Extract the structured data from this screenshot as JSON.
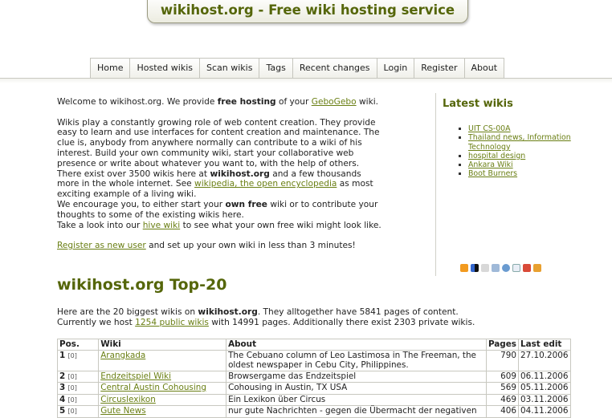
{
  "site": {
    "title": "wikihost.org - Free wiki hosting service"
  },
  "nav": {
    "tabs": [
      "Home",
      "Hosted wikis",
      "Scan wikis",
      "Tags",
      "Recent changes",
      "Login",
      "Register",
      "About"
    ]
  },
  "intro": {
    "p1_pre": "Welcome to wikihost.org. We provide ",
    "p1_bold": "free hosting",
    "p1_mid": " of your ",
    "p1_link": "GeboGebo",
    "p1_post": " wiki.",
    "p2_a": "Wikis play a constantly growing role of web content creation. They provide easy to learn and use interfaces for content creation and maintenance. The clue is, anybody from anywhere normally can contribute to a wiki of his interest. Build your own community wiki, start your collaborative web presence or write about whatever you want to, with the help of others. There exist over 3500 wikis here at ",
    "p2_bold": "wikihost.org",
    "p2_b": " and a few thousands more in the whole internet. See ",
    "p2_link": "wikipedia, the open encyclopedia",
    "p2_c": " as most exciting example of a living wiki.",
    "p2_d": "We encourage you, to either start your ",
    "p2_bold2": "own free",
    "p2_e": " wiki or to contribute your thoughts to some of the existing wikis here.",
    "p2_f": "Take a look into our ",
    "p2_link2": "hive wiki",
    "p2_g": " to see what your own free wiki might look like.",
    "p3_link": "Register as new user",
    "p3_post": " and set up your own wiki in less than 3 minutes!"
  },
  "sidebar": {
    "heading": "Latest wikis",
    "items": [
      "UIT CS-00A",
      "Thailand news, Information Technology",
      "hospital design",
      "Ankara Wiki",
      "Boot Burners"
    ]
  },
  "top20": {
    "title": "wikihost.org Top-20",
    "intro_a": "Here are the 20 biggest wikis on ",
    "intro_bold": "wikihost.org",
    "intro_b": ". They alltogether have 5841 pages of content.",
    "intro_c": "Currently we host ",
    "intro_link": "1254 public wikis",
    "intro_d": " with 14991 pages. Additionally there exist 2303 private wikis.",
    "headers": [
      "Pos.",
      "Wiki",
      "About",
      "Pages",
      "Last edit"
    ],
    "rows": [
      {
        "pos": "1",
        "zero": "[0]",
        "wiki": "Arangkada",
        "about": "The Cebuano column of Leo Lastimosa in The Freeman, the oldest newspaper in Cebu City, Philippines.",
        "pages": "790",
        "edit": "27.10.2006"
      },
      {
        "pos": "2",
        "zero": "[0]",
        "wiki": "Endzeitspiel Wiki",
        "about": "Browsergame das Endzeitspiel",
        "pages": "609",
        "edit": "06.11.2006"
      },
      {
        "pos": "3",
        "zero": "[0]",
        "wiki": "Central Austin Cohousing",
        "about": "Cohousing in Austin, TX USA",
        "pages": "569",
        "edit": "05.11.2006"
      },
      {
        "pos": "4",
        "zero": "[0]",
        "wiki": "Circuslexikon",
        "about": "Ein Lexikon über Circus",
        "pages": "469",
        "edit": "03.11.2006"
      },
      {
        "pos": "5",
        "zero": "[0]",
        "wiki": "Gute News",
        "about": "nur gute Nachrichten - gegen die Übermacht der negativen",
        "pages": "406",
        "edit": "04.11.2006"
      }
    ]
  }
}
